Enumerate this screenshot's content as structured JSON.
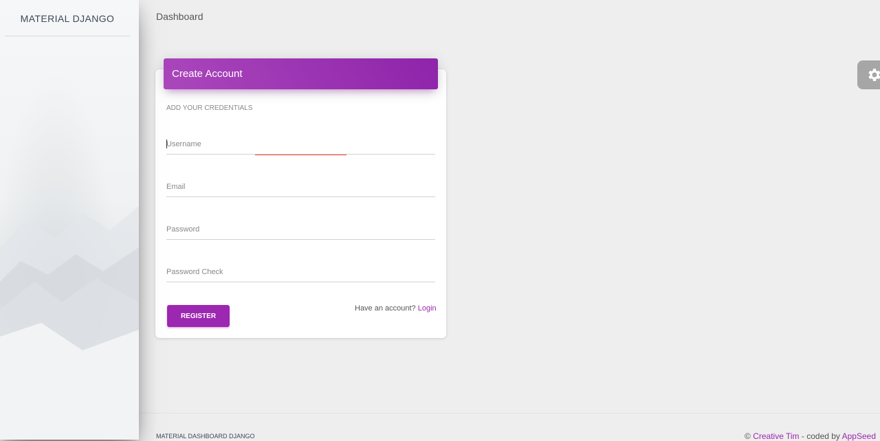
{
  "sidebar": {
    "logo_text": "MATERIAL DJANGO"
  },
  "navbar": {
    "brand": "Dashboard"
  },
  "card": {
    "title": "Create Account",
    "category": "ADD YOUR CREDENTIALS",
    "fields": {
      "username": {
        "placeholder": "Username",
        "value": ""
      },
      "email": {
        "placeholder": "Email",
        "value": ""
      },
      "password": {
        "placeholder": "Password",
        "value": ""
      },
      "password_check": {
        "placeholder": "Password Check",
        "value": ""
      }
    },
    "register_label": "REGISTER",
    "have_account_text": "Have an account?",
    "login_link": "Login"
  },
  "fixed_plugin": {
    "icon": "gear-icon"
  },
  "footer": {
    "left_text": "MATERIAL DASHBOARD DJANGO",
    "copyright_symbol": "©",
    "creative_tim": "Creative Tim",
    "coded_by": "- coded by",
    "appseed": "AppSeed"
  },
  "colors": {
    "primary": "#9c27b0",
    "header_gradient_start": "#ab47bc",
    "header_gradient_end": "#8e24aa",
    "focus_underline": "#f44336",
    "background": "#eeeeee"
  }
}
